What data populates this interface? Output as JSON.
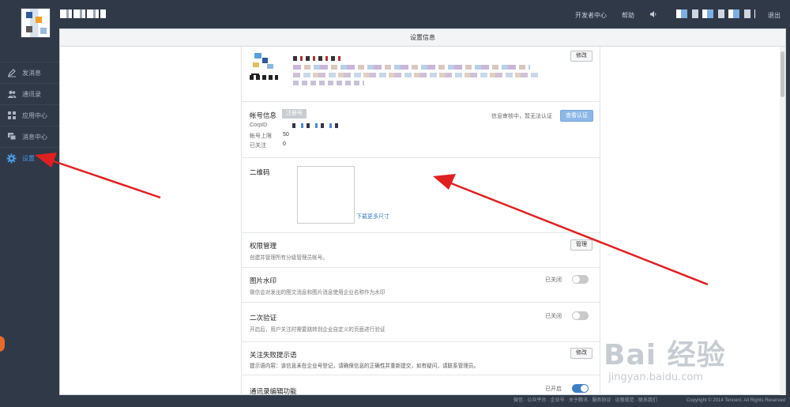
{
  "header": {
    "dev_center": "开发者中心",
    "help": "帮助",
    "logout": "退出"
  },
  "sidebar": {
    "items": [
      {
        "label": "发消息",
        "icon": "pencil-icon"
      },
      {
        "label": "通讯录",
        "icon": "contacts-icon"
      },
      {
        "label": "应用中心",
        "icon": "apps-icon"
      },
      {
        "label": "消息中心",
        "icon": "chat-icon"
      },
      {
        "label": "设置",
        "icon": "gear-icon",
        "active": true
      }
    ]
  },
  "panel": {
    "title": "设置信息",
    "profile": {
      "modify_label": "修改"
    },
    "account": {
      "title": "帐号信息",
      "badge": "注册号",
      "corpid_label": "CorpID",
      "limit_label": "帐号上限",
      "limit_value": "50",
      "followed_label": "已关注",
      "followed_value": "0",
      "verify_status": "信息审核中，暂无法认证",
      "verify_button": "查看认证"
    },
    "qrcode": {
      "title": "二维码",
      "download_link": "下载更多尺寸"
    },
    "permission": {
      "title": "权限管理",
      "desc": "创建并管理所有分级管理员帐号。",
      "button": "管理"
    },
    "watermark": {
      "title": "图片水印",
      "desc": "微信会对发出的图文消息和图片消息使用企业名称作为水印",
      "state": "已关闭",
      "on": false
    },
    "second_verify": {
      "title": "二次验证",
      "desc": "开启后，用户关注时需要跳转到企业自定义的页面进行验证",
      "state": "已关闭",
      "on": false
    },
    "follow_fail": {
      "title": "关注失败提示语",
      "desc": "提示语内容：该信息未在企业号登记，请确保信息的正确性并重新提交，如有疑问，请联系管理员。",
      "button": "修改"
    },
    "contacts_edit": {
      "title": "通讯录编辑功能",
      "state": "已开启",
      "on": true
    }
  },
  "footer": {
    "links": "微信 · 公众平台 · 企业号 · 关于腾讯 · 服务协议 · 运营规范 · 联系我们",
    "copyright": "Copyright © 2014 Tencent. All Rights Reserved"
  },
  "watermark_brand": {
    "big": "Bai 经验",
    "small": "jingyan.baidu.com"
  },
  "colors": {
    "background": "#2f3948",
    "accent": "#4a9be8",
    "toggle_on": "#3c7fc6",
    "arrow": "#e02020"
  }
}
